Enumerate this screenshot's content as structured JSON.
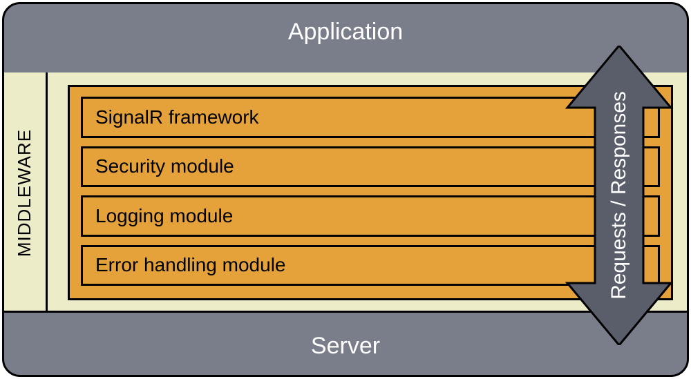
{
  "top_label": "Application",
  "bottom_label": "Server",
  "middleware_label": "MIDDLEWARE",
  "arrow_label": "Requests / Responses",
  "modules": [
    "SignalR framework",
    "Security module",
    "Logging module",
    "Error handling module"
  ],
  "colors": {
    "frame_grey": "#7a7d8a",
    "band_yellow": "#ecedc8",
    "module_orange": "#e5a23a",
    "arrow_fill": "#5a5d6a"
  }
}
